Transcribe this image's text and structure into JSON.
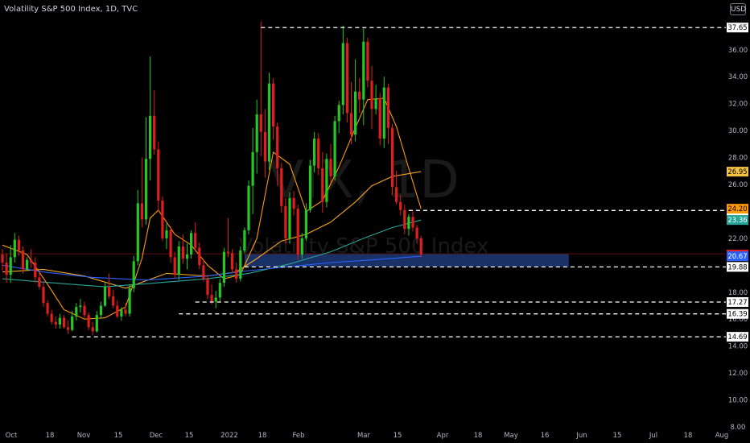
{
  "header": {
    "title": "Volatility S&P 500 Index, 1D, TVC",
    "currency": "USD"
  },
  "watermark": {
    "symbol": "VIX, 1D",
    "name": "Volatility S&P 500 Index"
  },
  "colors": {
    "background": "#000000",
    "up": "#26c826",
    "down": "#e01e1e",
    "ma_fast": "#ff9800",
    "ma_mid": "#26a69a",
    "ma_slow": "#2962ff",
    "zone": "#1e3a78",
    "level": "#ffffff",
    "axis_text": "#b2b5be"
  },
  "chart_data": {
    "type": "candlestick",
    "title": "Volatility S&P 500 Index, 1D, TVC",
    "xlabel": "",
    "ylabel": "",
    "ylim": [
      8,
      38.5
    ],
    "y_ticks": [
      8,
      10,
      12,
      14,
      16,
      18,
      20,
      22,
      24,
      26,
      28,
      30,
      32,
      34,
      36
    ],
    "x_ticks": [
      "Oct",
      "18",
      "Nov",
      "15",
      "Dec",
      "15",
      "2022",
      "18",
      "Feb",
      "Mar",
      "15",
      "Apr",
      "18",
      "May",
      "16",
      "Jun",
      "15",
      "Jul",
      "18",
      "Aug"
    ],
    "candles": [
      [
        0,
        20.8,
        21.2,
        19.6,
        20.2
      ],
      [
        1,
        20.2,
        20.9,
        18.7,
        19.3
      ],
      [
        2,
        19.3,
        21.5,
        18.7,
        20.6
      ],
      [
        3,
        20.6,
        22.4,
        20.2,
        21.9
      ],
      [
        4,
        21.9,
        22.2,
        20.7,
        21.1
      ],
      [
        5,
        21.1,
        21.4,
        19.4,
        19.7
      ],
      [
        6,
        19.7,
        20.6,
        19.6,
        20.4
      ],
      [
        7,
        20.4,
        21.2,
        19.8,
        20.2
      ],
      [
        8,
        20.2,
        20.6,
        18.7,
        19.1
      ],
      [
        9,
        19.1,
        19.5,
        18.2,
        18.4
      ],
      [
        10,
        18.4,
        18.8,
        16.9,
        17.2
      ],
      [
        11,
        17.2,
        17.4,
        16.2,
        16.4
      ],
      [
        12,
        16.4,
        16.7,
        15.6,
        15.8
      ],
      [
        13,
        15.8,
        16.2,
        15.3,
        15.6
      ],
      [
        14,
        15.6,
        16.4,
        15.3,
        16.1
      ],
      [
        15,
        16.1,
        16.3,
        15.3,
        15.4
      ],
      [
        16,
        15.4,
        15.9,
        14.9,
        15.2
      ],
      [
        17,
        15.2,
        16.6,
        15.1,
        16.2
      ],
      [
        18,
        16.2,
        17.2,
        15.9,
        16.9
      ],
      [
        19,
        16.9,
        17.5,
        16.5,
        17.0
      ],
      [
        20,
        17.0,
        17.3,
        16.1,
        16.3
      ],
      [
        21,
        16.3,
        16.5,
        15.2,
        15.4
      ],
      [
        22,
        15.4,
        15.8,
        14.8,
        15.1
      ],
      [
        23,
        15.1,
        16.6,
        15.0,
        16.3
      ],
      [
        24,
        16.3,
        17.3,
        16.0,
        17.0
      ],
      [
        25,
        17.0,
        18.7,
        16.9,
        18.4
      ],
      [
        26,
        18.4,
        19.4,
        17.5,
        17.7
      ],
      [
        27,
        17.7,
        18.2,
        16.8,
        17.0
      ],
      [
        28,
        17.0,
        17.4,
        16.1,
        16.2
      ],
      [
        29,
        16.2,
        16.9,
        15.9,
        16.7
      ],
      [
        30,
        16.7,
        17.2,
        16.2,
        16.4
      ],
      [
        31,
        16.4,
        18.6,
        16.2,
        18.3
      ],
      [
        32,
        18.3,
        20.7,
        18.0,
        20.3
      ],
      [
        33,
        20.3,
        25.6,
        20.0,
        24.6
      ],
      [
        34,
        24.6,
        28.0,
        22.8,
        23.4
      ],
      [
        35,
        23.4,
        31.0,
        23.0,
        27.9
      ],
      [
        36,
        27.9,
        35.5,
        26.3,
        31.1
      ],
      [
        37,
        31.1,
        33.0,
        28.2,
        28.6
      ],
      [
        38,
        28.6,
        29.2,
        24.0,
        24.8
      ],
      [
        39,
        24.8,
        25.1,
        21.8,
        22.0
      ],
      [
        40,
        22.0,
        23.1,
        21.2,
        22.6
      ],
      [
        41,
        22.6,
        22.9,
        20.2,
        20.6
      ],
      [
        42,
        20.6,
        21.0,
        19.0,
        19.3
      ],
      [
        43,
        19.3,
        21.8,
        18.9,
        21.4
      ],
      [
        44,
        21.4,
        22.3,
        20.1,
        20.5
      ],
      [
        45,
        20.5,
        21.6,
        19.7,
        20.8
      ],
      [
        46,
        20.8,
        22.6,
        20.5,
        22.4
      ],
      [
        47,
        22.4,
        23.2,
        21.0,
        21.3
      ],
      [
        48,
        21.3,
        21.7,
        19.7,
        20.0
      ],
      [
        49,
        20.0,
        20.4,
        18.8,
        19.0
      ],
      [
        50,
        19.0,
        19.3,
        17.5,
        17.8
      ],
      [
        51,
        17.8,
        18.6,
        17.1,
        17.3
      ],
      [
        52,
        17.3,
        18.1,
        16.8,
        17.6
      ],
      [
        53,
        17.6,
        19.0,
        17.3,
        18.7
      ],
      [
        54,
        18.7,
        21.3,
        18.4,
        21.0
      ],
      [
        55,
        21.0,
        23.5,
        20.6,
        20.9
      ],
      [
        56,
        20.9,
        21.2,
        19.4,
        19.7
      ],
      [
        57,
        19.7,
        20.2,
        18.7,
        19.0
      ],
      [
        58,
        19.0,
        21.4,
        18.8,
        21.1
      ],
      [
        59,
        21.1,
        22.8,
        20.9,
        22.6
      ],
      [
        60,
        22.6,
        26.3,
        22.3,
        25.9
      ],
      [
        61,
        25.9,
        30.2,
        23.8,
        28.4
      ],
      [
        62,
        28.4,
        32.3,
        26.8,
        31.2
      ],
      [
        63,
        31.2,
        38.1,
        28.1,
        29.9
      ],
      [
        64,
        29.9,
        31.6,
        26.5,
        27.7
      ],
      [
        65,
        27.7,
        34.3,
        27.1,
        33.5
      ],
      [
        66,
        33.5,
        33.9,
        29.3,
        30.3
      ],
      [
        67,
        30.3,
        30.6,
        25.9,
        27.2
      ],
      [
        68,
        27.2,
        27.6,
        23.9,
        24.4
      ],
      [
        69,
        24.4,
        25.0,
        21.6,
        22.0
      ],
      [
        70,
        22.0,
        25.4,
        21.6,
        25.0
      ],
      [
        71,
        25.0,
        25.5,
        23.7,
        24.2
      ],
      [
        72,
        24.2,
        24.5,
        20.4,
        20.8
      ],
      [
        73,
        20.8,
        22.4,
        20.5,
        22.0
      ],
      [
        74,
        22.0,
        24.6,
        21.8,
        24.1
      ],
      [
        75,
        24.1,
        27.8,
        23.9,
        27.4
      ],
      [
        76,
        27.4,
        29.9,
        26.9,
        29.4
      ],
      [
        77,
        29.4,
        29.8,
        26.7,
        27.2
      ],
      [
        78,
        27.2,
        28.4,
        23.9,
        24.7
      ],
      [
        79,
        24.7,
        28.3,
        24.3,
        27.9
      ],
      [
        80,
        27.9,
        29.0,
        26.1,
        26.6
      ],
      [
        81,
        26.6,
        31.1,
        26.3,
        30.7
      ],
      [
        82,
        30.7,
        32.2,
        29.8,
        31.9
      ],
      [
        83,
        31.9,
        37.8,
        31.2,
        36.5
      ],
      [
        84,
        36.5,
        36.9,
        30.6,
        31.3
      ],
      [
        85,
        31.3,
        33.6,
        29.0,
        29.7
      ],
      [
        86,
        29.7,
        35.3,
        29.2,
        32.9
      ],
      [
        87,
        32.9,
        33.9,
        31.3,
        32.3
      ],
      [
        88,
        32.3,
        37.6,
        30.4,
        36.6
      ],
      [
        89,
        36.6,
        36.9,
        33.2,
        33.7
      ],
      [
        90,
        33.7,
        34.8,
        30.1,
        31.6
      ],
      [
        91,
        31.6,
        33.4,
        31.2,
        32.4
      ],
      [
        92,
        32.4,
        32.8,
        28.9,
        29.4
      ],
      [
        93,
        29.4,
        34.0,
        28.7,
        33.2
      ],
      [
        94,
        33.2,
        33.5,
        29.0,
        30.2
      ],
      [
        95,
        30.2,
        30.5,
        25.2,
        25.8
      ],
      [
        96,
        25.8,
        27.0,
        24.5,
        24.7
      ],
      [
        97,
        24.7,
        25.2,
        23.7,
        24.1
      ],
      [
        98,
        24.1,
        24.5,
        22.3,
        22.7
      ],
      [
        99,
        22.7,
        23.8,
        22.2,
        23.6
      ],
      [
        100,
        23.6,
        24.0,
        22.5,
        22.8
      ],
      [
        101,
        22.8,
        23.0,
        21.6,
        22.0
      ],
      [
        102,
        22.0,
        22.2,
        20.6,
        20.8
      ]
    ],
    "moving_averages": [
      {
        "name": "",
        "color": "#ff9800",
        "values": [
          [
            0,
            21.5
          ],
          [
            6,
            20.8
          ],
          [
            11,
            18.6
          ],
          [
            15,
            16.7
          ],
          [
            20,
            16.0
          ],
          [
            25,
            16.1
          ],
          [
            30,
            16.9
          ],
          [
            34,
            20.5
          ],
          [
            36,
            23.5
          ],
          [
            38,
            24.1
          ],
          [
            42,
            22.3
          ],
          [
            46,
            21.5
          ],
          [
            50,
            20.0
          ],
          [
            54,
            19.0
          ],
          [
            58,
            19.3
          ],
          [
            62,
            22.0
          ],
          [
            66,
            28.4
          ],
          [
            70,
            27.5
          ],
          [
            74,
            24.0
          ],
          [
            78,
            24.8
          ],
          [
            82,
            27.3
          ],
          [
            86,
            30.2
          ],
          [
            89,
            32.3
          ],
          [
            93,
            32.4
          ],
          [
            96,
            30.3
          ],
          [
            99,
            27.2
          ],
          [
            102,
            24.2
          ]
        ]
      },
      {
        "name": "",
        "color": "#f5a623",
        "values": [
          [
            0,
            19.5
          ],
          [
            10,
            19.7
          ],
          [
            20,
            19.2
          ],
          [
            30,
            18.3
          ],
          [
            40,
            19.4
          ],
          [
            50,
            19.2
          ],
          [
            57,
            19.5
          ],
          [
            62,
            20.5
          ],
          [
            68,
            21.8
          ],
          [
            74,
            22.3
          ],
          [
            80,
            23.2
          ],
          [
            86,
            24.7
          ],
          [
            90,
            25.9
          ],
          [
            95,
            26.6
          ],
          [
            102,
            26.95
          ]
        ]
      },
      {
        "name": "",
        "color": "#26a69a",
        "values": [
          [
            0,
            19.0
          ],
          [
            12,
            18.7
          ],
          [
            25,
            18.4
          ],
          [
            38,
            18.7
          ],
          [
            50,
            19.0
          ],
          [
            60,
            19.4
          ],
          [
            70,
            20.1
          ],
          [
            80,
            21.0
          ],
          [
            88,
            22.0
          ],
          [
            95,
            22.8
          ],
          [
            102,
            23.36
          ]
        ]
      },
      {
        "name": "",
        "color": "#2962ff",
        "values": [
          [
            0,
            20.0
          ],
          [
            10,
            19.5
          ],
          [
            22,
            19.1
          ],
          [
            35,
            18.9
          ],
          [
            50,
            19.2
          ],
          [
            60,
            19.6
          ],
          [
            70,
            19.9
          ],
          [
            80,
            20.2
          ],
          [
            90,
            20.4
          ],
          [
            102,
            20.67
          ]
        ]
      }
    ],
    "levels": [
      {
        "value": 37.65,
        "from": 63,
        "label": "37.65"
      },
      {
        "value": 24.07,
        "from": 99,
        "label": "24.07"
      },
      {
        "value": 19.88,
        "from": 59,
        "label": "19.88"
      },
      {
        "value": 17.27,
        "from": 47,
        "label": "17.27"
      },
      {
        "value": 16.39,
        "from": 43,
        "label": "16.39"
      },
      {
        "value": 14.69,
        "from": 17,
        "label": "14.69"
      }
    ],
    "zone": {
      "from": 59,
      "to": 138,
      "low": 19.88,
      "high": 20.85
    },
    "price_tags": [
      {
        "value": 26.95,
        "label": "26.95",
        "color": "#f5c242",
        "text": "#000000"
      },
      {
        "value": 24.2,
        "label": "24.20",
        "color": "#ff9800",
        "text": "#000000"
      },
      {
        "value": 23.36,
        "label": "23.36",
        "color": "#26a69a",
        "text": "#ffffff"
      },
      {
        "value": 20.8,
        "label": "20.80",
        "color": "#e01e1e",
        "text": "#ffffff"
      },
      {
        "value": 20.67,
        "label": "20.67",
        "color": "#2962ff",
        "text": "#ffffff"
      }
    ]
  }
}
